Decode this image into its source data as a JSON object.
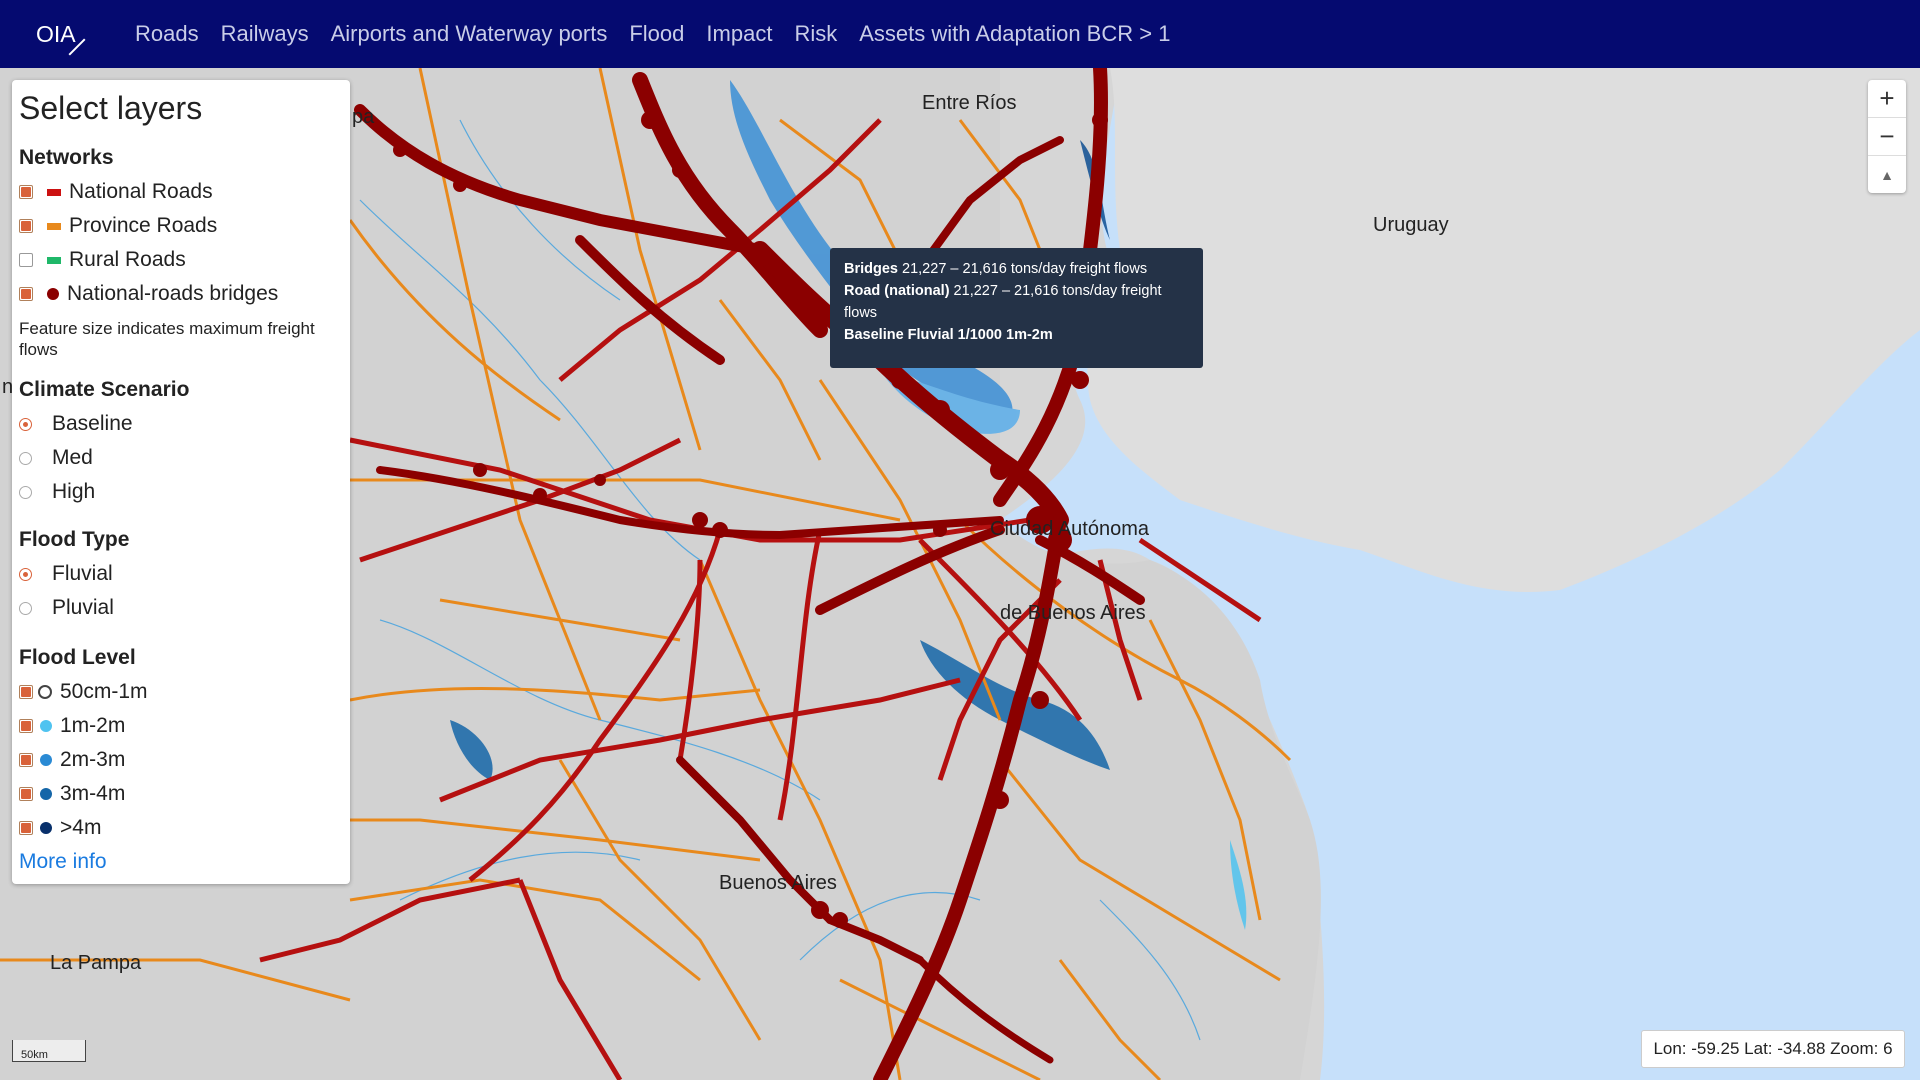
{
  "nav": {
    "brand": "OIA",
    "items": [
      "Roads",
      "Railways",
      "Airports and Waterway ports",
      "Flood",
      "Impact",
      "Risk",
      "Assets with Adaptation BCR > 1"
    ]
  },
  "panel": {
    "title": "Select layers",
    "networks": {
      "heading": "Networks",
      "items": [
        {
          "label": "National Roads",
          "checked": true,
          "color": "#cc1111"
        },
        {
          "label": "Province Roads",
          "checked": true,
          "color": "#e8891c"
        },
        {
          "label": "Rural Roads",
          "checked": false,
          "color": "#1fb869"
        },
        {
          "label": "National-roads bridges",
          "checked": true,
          "color": "#8b0000"
        }
      ],
      "note": "Feature size indicates maximum freight flows"
    },
    "climate": {
      "heading": "Climate Scenario",
      "options": [
        "Baseline",
        "Med",
        "High"
      ],
      "selected": "Baseline"
    },
    "flood_type": {
      "heading": "Flood Type",
      "options": [
        "Fluvial",
        "Pluvial"
      ],
      "selected": "Fluvial"
    },
    "flood_level": {
      "heading": "Flood Level",
      "items": [
        {
          "label": "50cm-1m",
          "checked": true,
          "color": "#ffffff"
        },
        {
          "label": "1m-2m",
          "checked": true,
          "color": "#4fc3f0"
        },
        {
          "label": "2m-3m",
          "checked": true,
          "color": "#2a8ad4"
        },
        {
          "label": "3m-4m",
          "checked": true,
          "color": "#1566a8"
        },
        {
          "label": ">4m",
          "checked": true,
          "color": "#08306b"
        }
      ]
    },
    "more_info": "More info"
  },
  "tooltip": {
    "line1_bold": "Bridges",
    "line1_text": " 21,227 – 21,616 tons/day freight flows",
    "line2_bold": "Road (national)",
    "line2_text": " 21,227 – 21,616 tons/day freight flows",
    "line3_bold": "Baseline Fluvial 1/1000 1m-2m"
  },
  "map_labels": {
    "entre_rios": "Entre Ríos",
    "uruguay": "Uruguay",
    "ciudad": "Ciudad Autónoma",
    "de_buenos_aires": "de Buenos Aires",
    "buenos_aires": "Buenos Aires",
    "la_pampa": "La Pampa",
    "fragment_top": "pa",
    "fragment_left": "n"
  },
  "zoom": {
    "in": "+",
    "out": "−",
    "north": "▲"
  },
  "coords": "Lon: -59.25 Lat: -34.88 Zoom: 6",
  "scale": "50km",
  "colors": {
    "navbar": "#050a70",
    "land": "#d6d6d6",
    "water": "#c6e0fa",
    "national_road": "#b51010",
    "province_road": "#e8891c",
    "bridge": "#8b0000"
  }
}
